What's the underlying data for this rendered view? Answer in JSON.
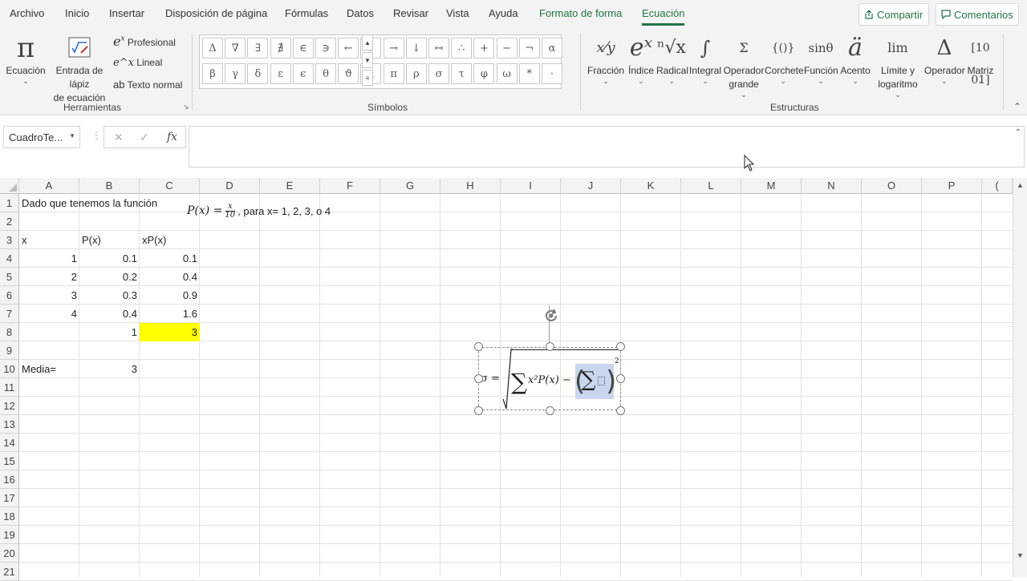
{
  "menu": {
    "tabs": [
      "Archivo",
      "Inicio",
      "Insertar",
      "Disposición de página",
      "Fórmulas",
      "Datos",
      "Revisar",
      "Vista",
      "Ayuda",
      "Formato de forma",
      "Ecuación"
    ],
    "share": "Compartir",
    "comments": "Comentarios"
  },
  "ribbon": {
    "tools": {
      "ecuacion": "Ecuación",
      "lapiz_1": "Entrada de lápiz",
      "lapiz_2": "de ecuación",
      "profesional": "Profesional",
      "lineal": "Lineal",
      "texto_normal": "Texto normal",
      "group": "Herramientas"
    },
    "symbols": {
      "row1": [
        "Δ",
        "∇",
        "∃",
        "∄",
        "∈",
        "∋",
        "←",
        "↑",
        "→",
        "↓",
        "↔",
        "∴",
        "+",
        "−",
        "¬",
        "α"
      ],
      "row2": [
        "β",
        "γ",
        "δ",
        "ε",
        "ϵ",
        "θ",
        "ϑ",
        "μ",
        "π",
        "ρ",
        "σ",
        "τ",
        "φ",
        "ω",
        "*",
        "·"
      ],
      "group": "Símbolos"
    },
    "structures": {
      "items": [
        {
          "icon": "x⁄y",
          "label": "Fracción"
        },
        {
          "icon": "eˣ",
          "label": "Índice"
        },
        {
          "icon": "ⁿ√x",
          "label": "Radical"
        },
        {
          "icon": "∫",
          "label": "Integral"
        },
        {
          "icon": "Σ",
          "label": "Operador",
          "label2": "grande"
        },
        {
          "icon": "{()}",
          "label": "Corchete"
        },
        {
          "icon": "sinθ",
          "label": "Función"
        },
        {
          "icon": "ä",
          "label": "Acento"
        },
        {
          "icon": "lim",
          "label": "Límite y",
          "label2": "logaritmo"
        },
        {
          "icon": "Δ",
          "label": "Operador"
        },
        {
          "icon": "[10 01]",
          "label": "Matriz"
        }
      ],
      "group": "Estructuras"
    }
  },
  "formula_bar": {
    "namebox": "CuadroTe...",
    "cancel": "✕",
    "enter": "✓",
    "fx": "fx",
    "value": ""
  },
  "grid": {
    "columns": [
      "A",
      "B",
      "C",
      "D",
      "E",
      "F",
      "G",
      "H",
      "I",
      "J",
      "K",
      "L",
      "M",
      "N",
      "O",
      "P"
    ],
    "rows": [
      "1",
      "2",
      "3",
      "4",
      "5",
      "6",
      "7",
      "8",
      "9",
      "10",
      "11",
      "12",
      "13",
      "14",
      "15",
      "16",
      "17",
      "18",
      "19",
      "20",
      "21"
    ],
    "cells": {
      "A1": "Dado que tenemos la función",
      "A3": "x",
      "B3": "P(x)",
      "C3": "xP(x)",
      "A4": "1",
      "B4": "0.1",
      "C4": "0.1",
      "A5": "2",
      "B5": "0.2",
      "C5": "0.4",
      "A6": "3",
      "B6": "0.3",
      "C6": "0.9",
      "A7": "4",
      "B7": "0.4",
      "C7": "1.6",
      "B8": "1",
      "C8": "3",
      "A10": "Media=",
      "B10": "3"
    },
    "highlight_color": "#ffff00"
  },
  "equations": {
    "function": {
      "lhs": "P(x) =",
      "num": "x",
      "den": "10",
      "suffix": ", para x= 1, 2, 3, o 4"
    },
    "sigma": {
      "lhs": "σ =",
      "sum": "∑",
      "body": "x²P(x) −",
      "inner_sum": "∑",
      "exp": "2"
    }
  },
  "colors": {
    "accent": "#217346",
    "selection": "#c8d6ee"
  }
}
